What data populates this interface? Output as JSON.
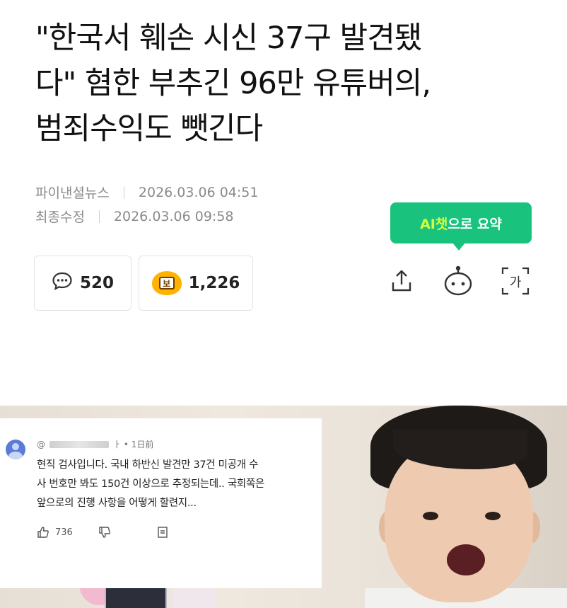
{
  "article": {
    "headline_lines": [
      "\"한국서 훼손 시신 37구 발견됐",
      "다\" 혐한 부추긴 96만 유튜버의,",
      "범죄수익도 뺏긴다"
    ],
    "publisher": "파이낸셜뉴스",
    "published": "2026.03.06 04:51",
    "modified_label": "최종수정",
    "modified": "2026.03.06 09:58"
  },
  "ai_summary": {
    "prefix": "AI챗",
    "suffix": "으로 요약"
  },
  "stats": {
    "comments": "520",
    "reactions": "1,226",
    "reaction_badge": "보"
  },
  "actions": {
    "font_label": "가"
  },
  "embedded_comment": {
    "handle_prefix": "@",
    "handle_suffix": "ㅏ • 1日前",
    "lines": [
      "현직 검사입니다. 국내 하반신 발견만 37건 미공개 수",
      "사 번호만 봐도 150건 이상으로 추정되는데.. 국회쪽은",
      "앞으로의 진행 사항을 어떻게 할련지..."
    ],
    "likes": "736"
  },
  "colors": {
    "accent": "#19c37d",
    "highlight": "#d8ff3a",
    "meta": "#8a8a8a"
  },
  "icons": [
    "comment-icon",
    "reaction-emoji-icon",
    "share-icon",
    "bot-icon",
    "font-size-icon",
    "thumbs-up-icon",
    "thumbs-down-icon",
    "reply-icon"
  ]
}
